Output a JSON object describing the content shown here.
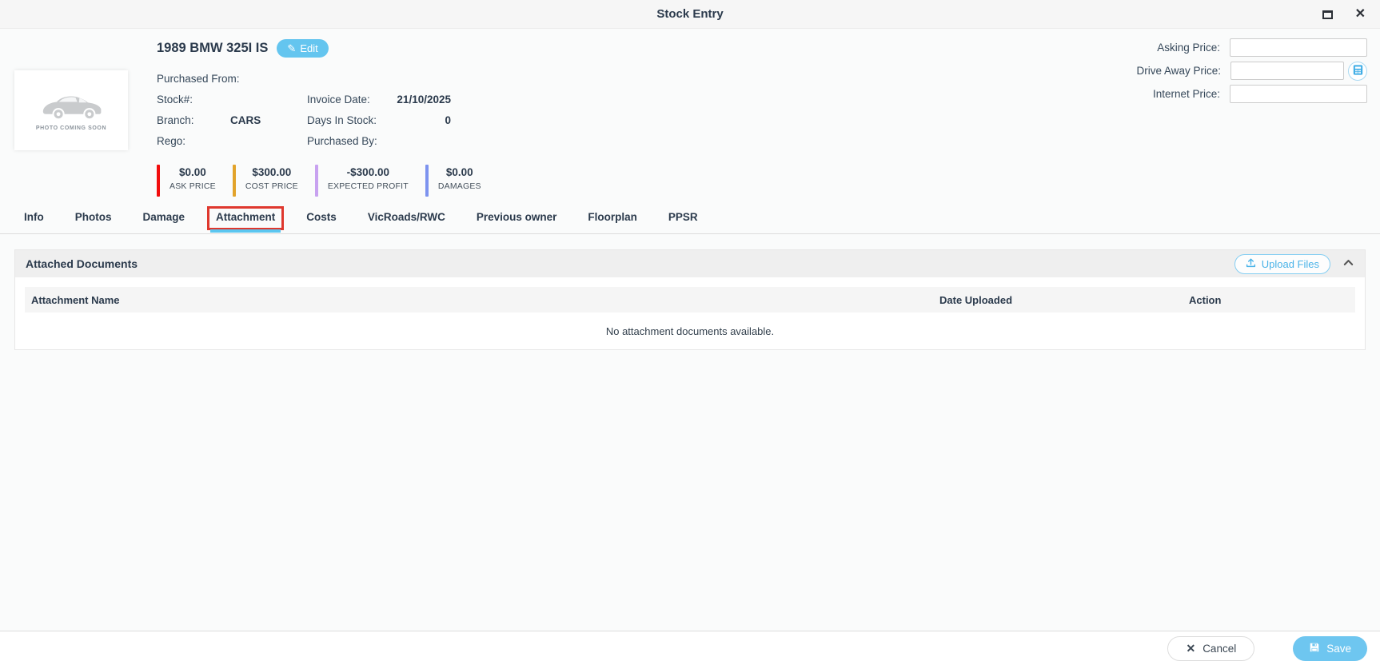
{
  "window": {
    "title": "Stock Entry"
  },
  "icons": {
    "close_glyph": "✕",
    "edit_glyph": "✎",
    "cancel_glyph": "✕"
  },
  "colors": {
    "accent_blue": "#64c5ef",
    "tab_underline": "#5bc6f0",
    "annotation_red": "#df382e",
    "ask_price_bar": "#f20d0d",
    "cost_price_bar": "#e2a32a",
    "expected_profit_bar": "#c8a2f0",
    "damages_bar": "#7d93ef"
  },
  "vehicle": {
    "title": "1989 BMW 325I IS",
    "edit_button": "Edit",
    "photo_placeholder": "PHOTO COMING SOON",
    "fields": {
      "purchased_from": {
        "label": "Purchased From:",
        "value": ""
      },
      "stock": {
        "label": "Stock#:",
        "value": ""
      },
      "invoice_date": {
        "label": "Invoice Date:",
        "value": "21/10/2025"
      },
      "branch": {
        "label": "Branch:",
        "value": "CARS"
      },
      "days_in_stock": {
        "label": "Days In Stock:",
        "value": "0"
      },
      "rego": {
        "label": "Rego:",
        "value": ""
      },
      "purchased_by": {
        "label": "Purchased By:",
        "value": ""
      }
    },
    "summary_badges": [
      {
        "value": "$0.00",
        "label": "ASK PRICE",
        "color": "#f20d0d"
      },
      {
        "value": "$300.00",
        "label": "COST PRICE",
        "color": "#e2a32a"
      },
      {
        "value": "-$300.00",
        "label": "EXPECTED PROFIT",
        "color": "#c8a2f0"
      },
      {
        "value": "$0.00",
        "label": "DAMAGES",
        "color": "#7d93ef"
      }
    ]
  },
  "pricing_panel": {
    "asking": {
      "label": "Asking Price:",
      "value": "",
      "placeholder": ""
    },
    "drive_away": {
      "label": "Drive Away Price:",
      "value": "",
      "placeholder": ""
    },
    "internet": {
      "label": "Internet Price:",
      "value": "",
      "placeholder": ""
    }
  },
  "tabs": {
    "active": "Attachment",
    "items": [
      {
        "label": "Info"
      },
      {
        "label": "Photos"
      },
      {
        "label": "Damage"
      },
      {
        "label": "Attachment"
      },
      {
        "label": "Costs"
      },
      {
        "label": "VicRoads/RWC"
      },
      {
        "label": "Previous owner"
      },
      {
        "label": "Floorplan"
      },
      {
        "label": "PPSR"
      }
    ]
  },
  "attachments_section": {
    "title": "Attached Documents",
    "upload_button": "Upload Files",
    "table": {
      "columns": [
        "Attachment Name",
        "Date Uploaded",
        "Action"
      ],
      "rows": [],
      "empty_message": "No attachment documents available."
    }
  },
  "footer": {
    "cancel_button": "Cancel",
    "save_button": "Save"
  }
}
